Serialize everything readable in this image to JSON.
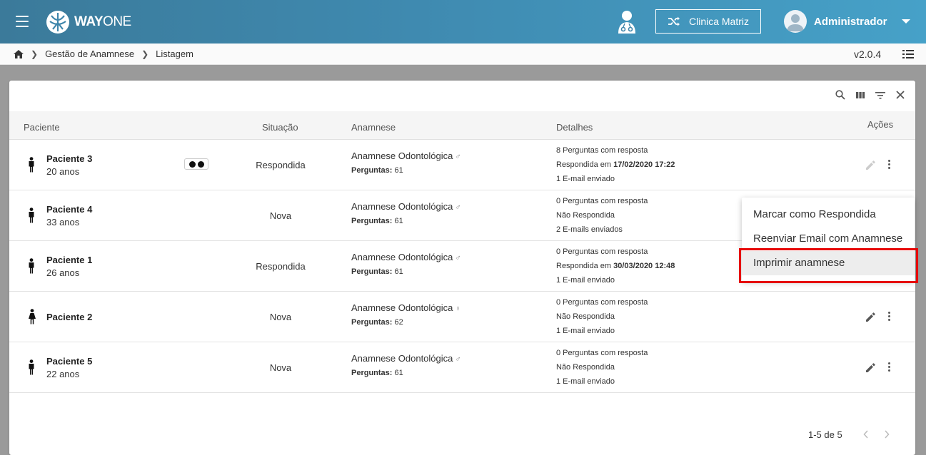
{
  "app": {
    "logo_main": "WAY",
    "logo_thin": "ONE",
    "clinic_button": "Clinica Matriz",
    "user_name": "Administrador"
  },
  "breadcrumb": {
    "items": [
      "Gestão de Anamnese",
      "Listagem"
    ],
    "version": "v2.0.4"
  },
  "table": {
    "headers": {
      "paciente": "Paciente",
      "situacao": "Situação",
      "anamnese": "Anamnese",
      "detalhes": "Detalhes",
      "acoes": "Ações"
    },
    "rows": [
      {
        "name": "Paciente 3",
        "age": "20 anos",
        "gender": "male",
        "has_eyes_badge": true,
        "situacao": "Respondida",
        "anamnese": "Anamnese Odontológica",
        "gender_symbol": "♂",
        "perguntas_label": "Perguntas:",
        "perguntas": "61",
        "det1": "8 Perguntas com resposta",
        "det2_prefix": "Respondida em",
        "det2_bold": "17/02/2020 17:22",
        "det3": "1 E-mail enviado",
        "edit_enabled": false
      },
      {
        "name": "Paciente 4",
        "age": "33 anos",
        "gender": "male",
        "has_eyes_badge": false,
        "situacao": "Nova",
        "anamnese": "Anamnese Odontológica",
        "gender_symbol": "♂",
        "perguntas_label": "Perguntas:",
        "perguntas": "61",
        "det1": "0 Perguntas com resposta",
        "det2_prefix": "Não Respondida",
        "det2_bold": "",
        "det3": "2 E-mails enviados",
        "edit_enabled": true
      },
      {
        "name": "Paciente 1",
        "age": "26 anos",
        "gender": "male",
        "has_eyes_badge": false,
        "situacao": "Respondida",
        "anamnese": "Anamnese Odontológica",
        "gender_symbol": "♂",
        "perguntas_label": "Perguntas:",
        "perguntas": "61",
        "det1": "0 Perguntas com resposta",
        "det2_prefix": "Respondida em",
        "det2_bold": "30/03/2020 12:48",
        "det3": "1 E-mail enviado",
        "edit_enabled": true
      },
      {
        "name": "Paciente 2",
        "age": "",
        "gender": "female",
        "has_eyes_badge": false,
        "situacao": "Nova",
        "anamnese": "Anamnese Odontológica",
        "gender_symbol": "♀",
        "perguntas_label": "Perguntas:",
        "perguntas": "62",
        "det1": "0 Perguntas com resposta",
        "det2_prefix": "Não Respondida",
        "det2_bold": "",
        "det3": "1 E-mail enviado",
        "edit_enabled": true
      },
      {
        "name": "Paciente 5",
        "age": "22 anos",
        "gender": "male",
        "has_eyes_badge": false,
        "situacao": "Nova",
        "anamnese": "Anamnese Odontológica",
        "gender_symbol": "♂",
        "perguntas_label": "Perguntas:",
        "perguntas": "61",
        "det1": "0 Perguntas com resposta",
        "det2_prefix": "Não Respondida",
        "det2_bold": "",
        "det3": "1 E-mail enviado",
        "edit_enabled": true
      }
    ]
  },
  "pagination": {
    "label": "1-5 de 5"
  },
  "context_menu": {
    "items": [
      "Marcar como Respondida",
      "Reenviar Email com Anamnese",
      "Imprimir anamnese"
    ],
    "highlighted_item": "Imprimir anamnese"
  },
  "colors": {
    "highlight": "#e60000",
    "topbar_start": "#3b7a9a",
    "topbar_end": "#46a1c8"
  }
}
